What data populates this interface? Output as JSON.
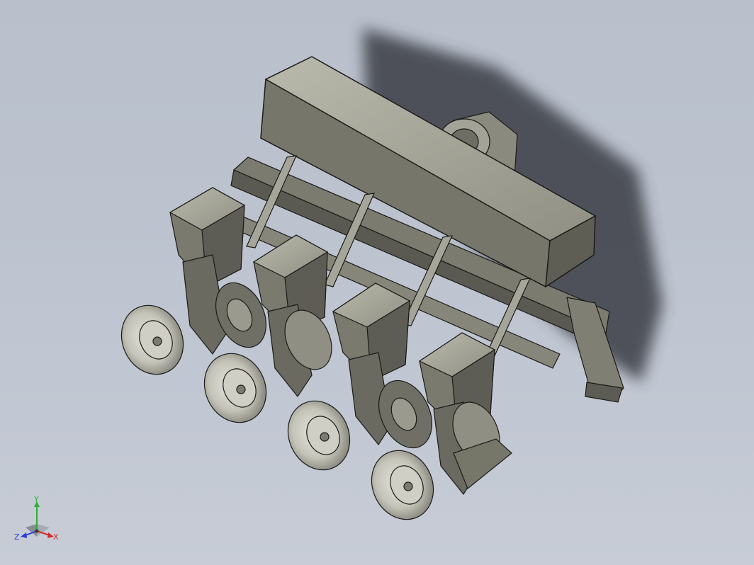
{
  "viewport": {
    "background_top": "#b9c0cc",
    "background_bottom": "#c7ccd6",
    "model_fill": "#8d8d80",
    "model_dark": "#57574f",
    "model_light": "#bdbdb0",
    "edge_color": "#1a1a18",
    "shadow_color": "#3a3e44"
  },
  "triad": {
    "x_label": "X",
    "y_label": "Y",
    "z_label": "Z",
    "x_color": "#d42a2a",
    "y_color": "#2fae2f",
    "z_color": "#2a3fd4"
  }
}
